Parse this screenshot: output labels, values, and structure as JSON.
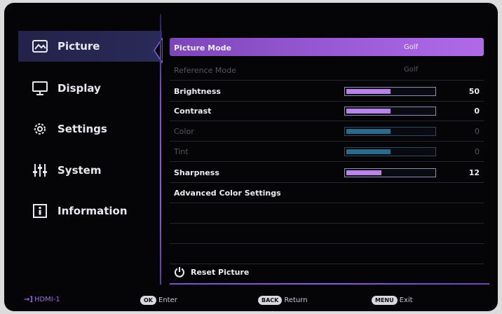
{
  "sidebar": {
    "items": [
      {
        "label": "Picture",
        "icon": "picture-icon",
        "active": true
      },
      {
        "label": "Display",
        "icon": "monitor-icon",
        "active": false
      },
      {
        "label": "Settings",
        "icon": "gear-icon",
        "active": false
      },
      {
        "label": "System",
        "icon": "sliders-icon",
        "active": false
      },
      {
        "label": "Information",
        "icon": "info-icon",
        "active": false
      }
    ]
  },
  "menu": {
    "picture_mode": {
      "label": "Picture Mode",
      "value": "Golf"
    },
    "reference_mode": {
      "label": "Reference Mode",
      "value": "Golf"
    },
    "brightness": {
      "label": "Brightness",
      "value": "50",
      "level": 0.5
    },
    "contrast": {
      "label": "Contrast",
      "value": "0",
      "level": 0.5
    },
    "color": {
      "label": "Color",
      "value": "0",
      "level": 0.5
    },
    "tint": {
      "label": "Tint",
      "value": "0",
      "level": 0.5
    },
    "sharpness": {
      "label": "Sharpness",
      "value": "12",
      "level": 0.4
    },
    "advanced": {
      "label": "Advanced Color Settings"
    },
    "reset": {
      "label": "Reset Picture"
    }
  },
  "footer": {
    "input": "HDMI-1",
    "ok_key": "OK",
    "ok_label": "Enter",
    "back_key": "BACK",
    "back_label": "Return",
    "menu_key": "MENU",
    "menu_label": "Exit"
  },
  "colors": {
    "accent": "#9b5ad6",
    "highlight": "#b06ae8",
    "bar_fill": "#b884e8",
    "dim_fill": "#2c6a8a"
  }
}
